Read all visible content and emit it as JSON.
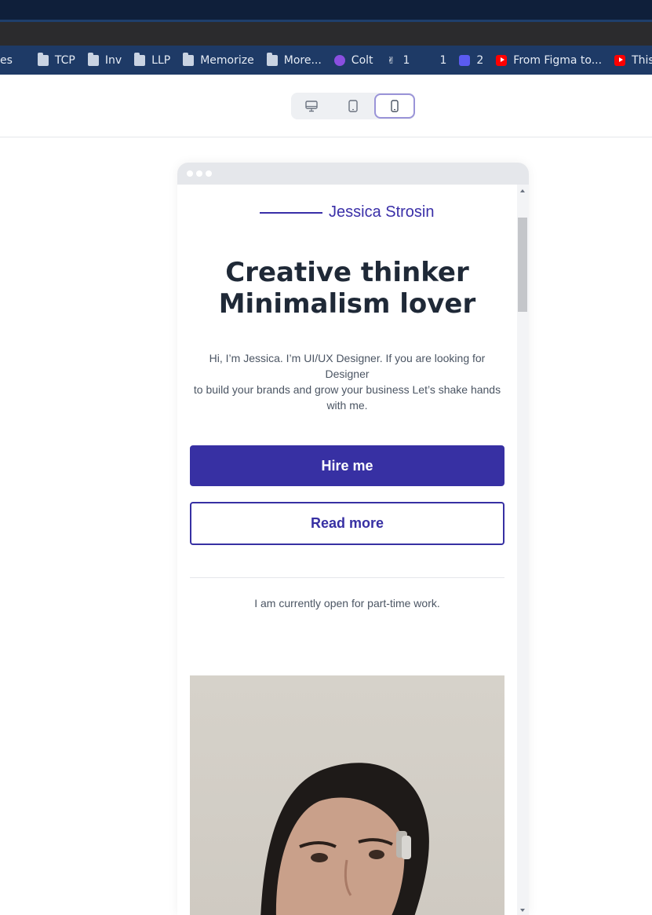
{
  "bookmarks": [
    {
      "label": "es",
      "icon": "folder-icon"
    },
    {
      "label": "TCP",
      "icon": "folder-icon"
    },
    {
      "label": "Inv",
      "icon": "folder-icon"
    },
    {
      "label": "LLP",
      "icon": "folder-icon"
    },
    {
      "label": "Memorize",
      "icon": "folder-icon"
    },
    {
      "label": "More...",
      "icon": "folder-icon"
    },
    {
      "label": "Colt",
      "icon": "colt-icon"
    },
    {
      "label": "1",
      "icon": "peace-hand-icon"
    },
    {
      "label": "1",
      "icon": "figma-icon"
    },
    {
      "label": "2",
      "icon": "square-app-icon"
    },
    {
      "label": "From Figma to...",
      "icon": "youtube-icon"
    },
    {
      "label": "This",
      "icon": "youtube-icon"
    }
  ],
  "device_switcher": {
    "options": [
      "desktop",
      "tablet",
      "mobile"
    ],
    "active": "mobile"
  },
  "site": {
    "brand": "Jessica Strosin",
    "headline_line1": "Creative thinker",
    "headline_line2": "Minimalism lover",
    "intro_line1": "Hi, I’m Jessica. I’m UI/UX Designer. If you are looking for Designer",
    "intro_line2": "to build your brands and grow your business Let’s shake hands with me.",
    "hire_label": "Hire me",
    "read_more_label": "Read more",
    "status": "I am currently open for part-time work."
  },
  "colors": {
    "accent": "#3730a3",
    "heading": "#1f2937",
    "body_text": "#4b5563",
    "bookmarks_bar": "#1e3a66"
  }
}
